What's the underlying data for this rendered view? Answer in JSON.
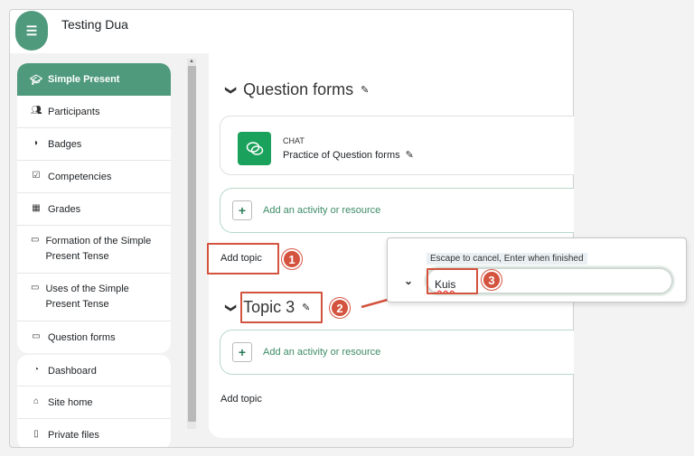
{
  "header": {
    "menu_icon": "hamburger-icon",
    "course_title": "Testing Dua"
  },
  "sidebar": {
    "course_name": "Simple Present",
    "items": [
      {
        "label": "Participants",
        "icon": "users-icon"
      },
      {
        "label": "Badges",
        "icon": "shield-icon"
      },
      {
        "label": "Competencies",
        "icon": "checkbox-icon"
      },
      {
        "label": "Grades",
        "icon": "table-icon"
      },
      {
        "label": "Formation of the Simple Present Tense",
        "icon": "folder-icon"
      },
      {
        "label": "Uses of the Simple Present Tense",
        "icon": "folder-icon"
      },
      {
        "label": "Question forms",
        "icon": "folder-icon"
      }
    ],
    "nav_items": [
      {
        "label": "Dashboard",
        "icon": "dashboard-icon"
      },
      {
        "label": "Site home",
        "icon": "home-icon"
      },
      {
        "label": "Private files",
        "icon": "file-icon"
      }
    ]
  },
  "main": {
    "section1_title": "Question forms",
    "activity": {
      "type": "CHAT",
      "name": "Practice of Question forms"
    },
    "add_activity_label": "Add an activity or resource",
    "add_topic_label": "Add topic",
    "section2_title": "Topic 3",
    "add_activity_label_2": "Add an activity or resource",
    "add_topic_label_2": "Add topic"
  },
  "inline_edit": {
    "hint": "Escape to cancel, Enter when finished",
    "value": "Kuis"
  },
  "annotations": {
    "badge1": "1",
    "badge2": "2",
    "badge3": "3",
    "color": "#d3533e"
  },
  "colors": {
    "brand": "#4f9a7c",
    "chat_icon": "#1aa15b",
    "link": "#3d8b67"
  }
}
